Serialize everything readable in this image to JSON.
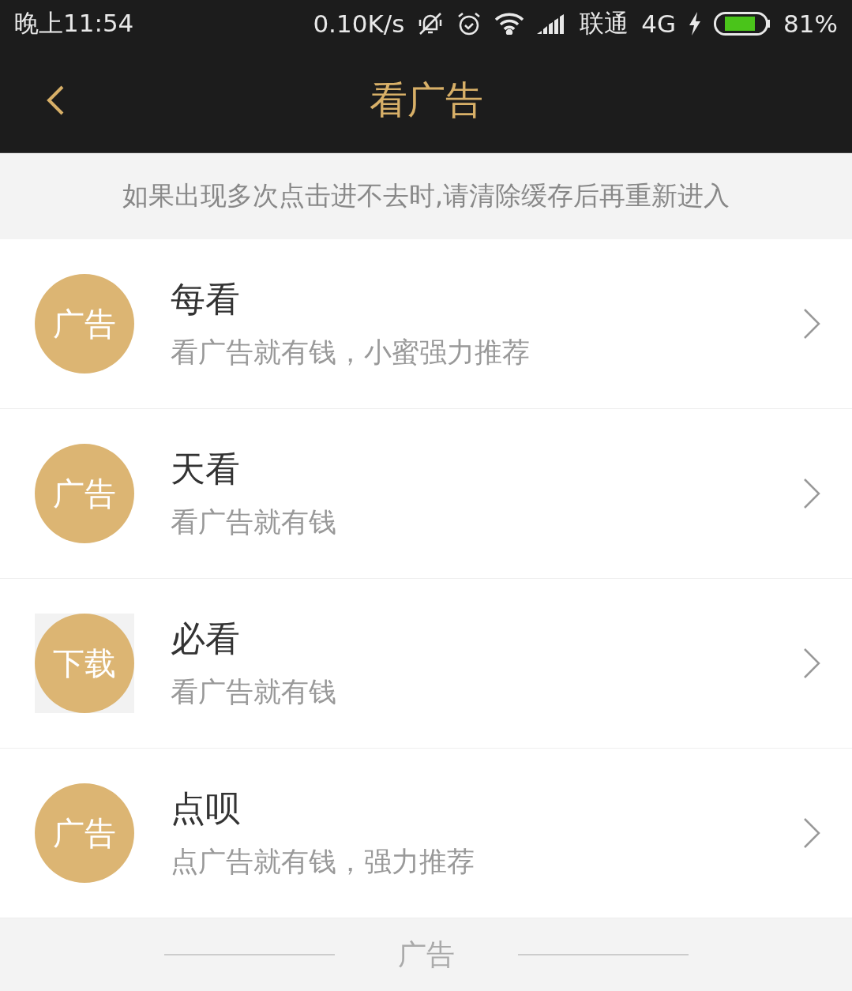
{
  "status_bar": {
    "time": "晚上11:54",
    "speed": "0.10K/s",
    "carrier": "联通",
    "network": "4G",
    "battery_text": "81%"
  },
  "header": {
    "title": "看广告"
  },
  "notice": "如果出现多次点击进不去时,请清除缓存后再重新进入",
  "items": [
    {
      "badge": "广告",
      "kind": "plain",
      "title": "每看",
      "subtitle": "看广告就有钱，小蜜强力推荐"
    },
    {
      "badge": "广告",
      "kind": "plain",
      "title": "天看",
      "subtitle": "看广告就有钱"
    },
    {
      "badge": "下载",
      "kind": "framed",
      "title": "必看",
      "subtitle": "看广告就有钱"
    },
    {
      "badge": "广告",
      "kind": "plain",
      "title": "点呗",
      "subtitle": "点广告就有钱，强力推荐"
    }
  ],
  "footer": "广告"
}
